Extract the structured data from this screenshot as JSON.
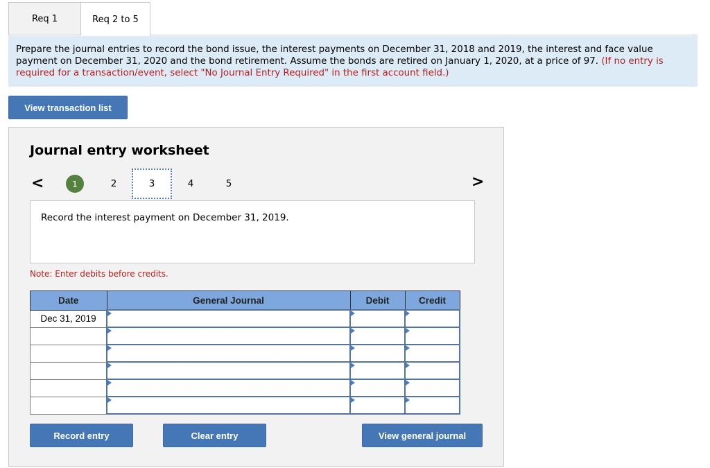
{
  "tabs": [
    {
      "label": "Req 1",
      "active": false
    },
    {
      "label": "Req 2 to 5",
      "active": true
    }
  ],
  "instructions": {
    "main": "Prepare the journal entries to record the bond issue, the interest payments on December 31, 2018 and 2019,  the interest and face value payment on December 31, 2020 and the bond retirement. Assume the bonds are retired on January 1, 2020, at a price of  97.",
    "note_red": "(If no entry is required for a transaction/event, select \"No Journal Entry Required\" in the first account field.)"
  },
  "buttons": {
    "view_transaction_list": "View transaction list",
    "record_entry": "Record entry",
    "clear_entry": "Clear entry",
    "view_general_journal": "View general journal"
  },
  "worksheet": {
    "title": "Journal entry worksheet",
    "nav_prev": "<",
    "nav_next": ">",
    "steps": [
      "1",
      "2",
      "3",
      "4",
      "5"
    ],
    "completed_step": "1",
    "current_step": "3",
    "prompt": "Record the interest payment on December 31, 2019.",
    "note": "Note: Enter debits before credits."
  },
  "table": {
    "headers": {
      "date": "Date",
      "account": "General Journal",
      "debit": "Debit",
      "credit": "Credit"
    },
    "rows": [
      {
        "date": "Dec 31, 2019",
        "account": "",
        "debit": "",
        "credit": ""
      },
      {
        "date": "",
        "account": "",
        "debit": "",
        "credit": ""
      },
      {
        "date": "",
        "account": "",
        "debit": "",
        "credit": ""
      },
      {
        "date": "",
        "account": "",
        "debit": "",
        "credit": ""
      },
      {
        "date": "",
        "account": "",
        "debit": "",
        "credit": ""
      },
      {
        "date": "",
        "account": "",
        "debit": "",
        "credit": ""
      }
    ]
  },
  "colors": {
    "button_blue": "#4577b6",
    "instruction_bg": "#ddebf7",
    "table_header": "#7ea8dd",
    "step_done_green": "#55813f",
    "note_red": "#b22222"
  }
}
